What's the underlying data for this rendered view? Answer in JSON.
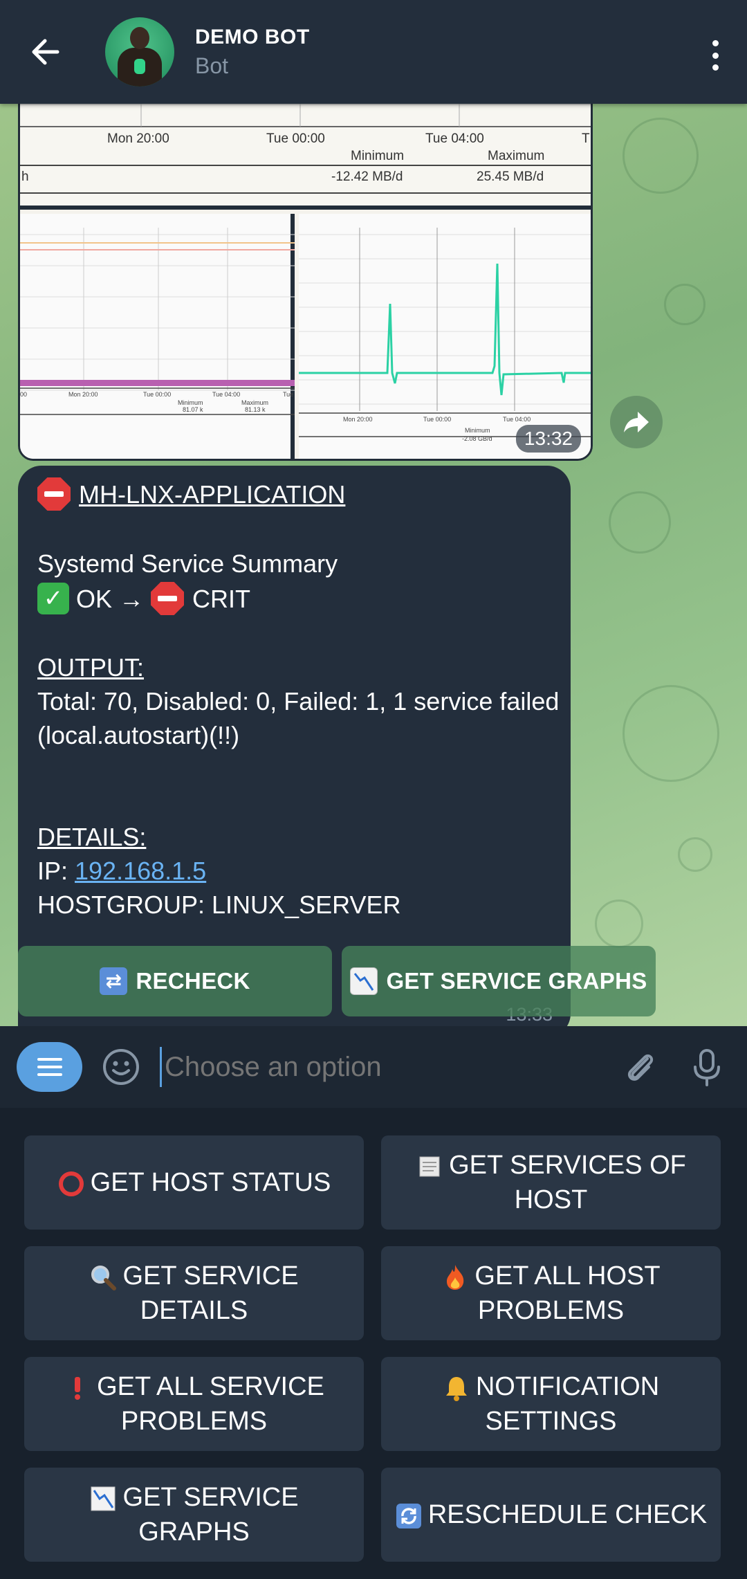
{
  "header": {
    "title": "DEMO BOT",
    "subtitle": "Bot"
  },
  "album": {
    "top_graph": {
      "x_ticks": [
        "Mon 20:00",
        "Tue 00:00",
        "Tue 04:00",
        "T"
      ],
      "minimum_label": "Minimum",
      "maximum_label": "Maximum",
      "unit_fragment": "h",
      "minimum_value": "-12.42 MB/d",
      "maximum_value": "25.45 MB/d"
    },
    "left_graph": {
      "x_ticks": [
        "00",
        "Mon 20:00",
        "Tue 00:00",
        "Tue 04:00",
        "Tue"
      ],
      "minimum_label": "Minimum",
      "maximum_label": "Maximum",
      "minimum_value": "81.07 k",
      "maximum_value": "81.13 k"
    },
    "right_graph": {
      "x_ticks": [
        "Mon 20:00",
        "Tue 00:00",
        "Tue 04:00"
      ],
      "minimum_label": "Minimum",
      "minimum_value": "-2.08 GB/d"
    },
    "time": "13:32"
  },
  "message": {
    "host_name": "MH-LNX-APPLICATION",
    "service": "Systemd Service Summary",
    "state_from": "OK",
    "arrow": "→",
    "state_to": "CRIT",
    "output_heading": "OUTPUT:",
    "output_line1": "Total: 70, Disabled: 0, Failed: 1, 1 service failed",
    "output_line2": "(local.autostart)(!!)",
    "details_heading": "DETAILS:",
    "ip_label": "IP:",
    "ip_value": "192.168.1.5",
    "hostgroup": "HOSTGROUP: LINUX_SERVER",
    "time": "13:33"
  },
  "inline_buttons": {
    "recheck": "RECHECK",
    "graphs": "GET SERVICE GRAPHS"
  },
  "input": {
    "placeholder": "Choose an option"
  },
  "keyboard": {
    "host_status": "GET HOST STATUS",
    "services_of_host": "GET SERVICES OF HOST",
    "service_details": "GET SERVICE DETAILS",
    "all_host_problems": "GET ALL HOST PROBLEMS",
    "all_service_problems": "GET ALL SERVICE PROBLEMS",
    "notification_settings": "NOTIFICATION SETTINGS",
    "service_graphs": "GET SERVICE GRAPHS",
    "reschedule_check": "RESCHEDULE CHECK"
  },
  "colors": {
    "header_bg": "#232e3c",
    "bubble_bg": "#232e3c",
    "link": "#6ab3f3",
    "accent": "#5aa0e0",
    "crit": "#e23a3a",
    "ok": "#37b24d",
    "graph_line": "#2bd1a4",
    "graph_band": "#b860b0"
  },
  "icons": {
    "back": "arrow-left-icon",
    "more": "more-vertical-icon",
    "share": "share-icon",
    "menu": "menu-icon",
    "emoji": "emoji-icon",
    "attach": "paperclip-icon",
    "mic": "microphone-icon"
  }
}
